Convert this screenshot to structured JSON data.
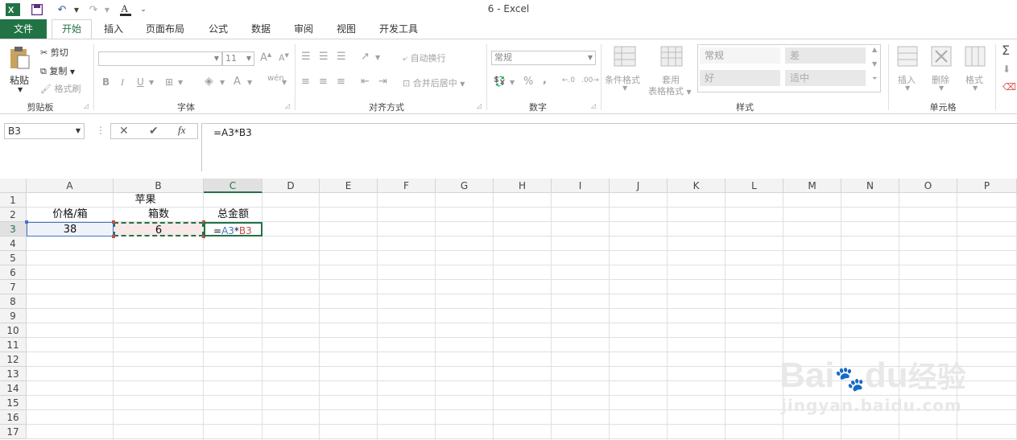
{
  "window": {
    "title": "6 - Excel"
  },
  "tabs": [
    {
      "label": "文件"
    },
    {
      "label": "开始"
    },
    {
      "label": "插入"
    },
    {
      "label": "页面布局"
    },
    {
      "label": "公式"
    },
    {
      "label": "数据"
    },
    {
      "label": "审阅"
    },
    {
      "label": "视图"
    },
    {
      "label": "开发工具"
    }
  ],
  "clipboard": {
    "paste": "粘贴",
    "cut": "剪切",
    "copy": "复制",
    "format_painter": "格式刷",
    "label": "剪贴板"
  },
  "font": {
    "size": "11",
    "label": "字体"
  },
  "alignment": {
    "wrap": "自动换行",
    "merge": "合并后居中",
    "label": "对齐方式"
  },
  "number": {
    "format": "常规",
    "label": "数字"
  },
  "styles": {
    "cond_format": "条件格式",
    "table_format_1": "套用",
    "table_format_2": "表格格式",
    "normal": "常规",
    "bad": "差",
    "good": "好",
    "neutral": "适中",
    "label": "样式"
  },
  "cells": {
    "insert": "插入",
    "delete": "删除",
    "format": "格式",
    "label": "单元格"
  },
  "formula_bar": {
    "name_box": "B3",
    "formula": "=A3*B3",
    "fx": "fx"
  },
  "grid": {
    "columns": [
      "A",
      "B",
      "C",
      "D",
      "E",
      "F",
      "G",
      "H",
      "I",
      "J",
      "K",
      "L",
      "M",
      "N",
      "O",
      "P"
    ],
    "rows": [
      "1",
      "2",
      "3",
      "4",
      "5",
      "6",
      "7",
      "8",
      "9",
      "10",
      "11",
      "12",
      "13",
      "14",
      "15",
      "16",
      "17"
    ],
    "selected_column": "C",
    "cells": {
      "B1": "苹果",
      "A2": "价格/箱",
      "B2": "箱数",
      "C2": "总金额",
      "A3": "38",
      "B3": "6",
      "C3_parts": [
        "=",
        "A3",
        "*",
        "B3"
      ]
    },
    "colors": {
      "accent": "#217346",
      "ref_a": "#4472c4",
      "ref_b": "#c0504d"
    }
  },
  "watermark": {
    "brand": "Bai",
    "du": "du",
    "cn": "经验",
    "url": "jingyan.baidu.com"
  }
}
